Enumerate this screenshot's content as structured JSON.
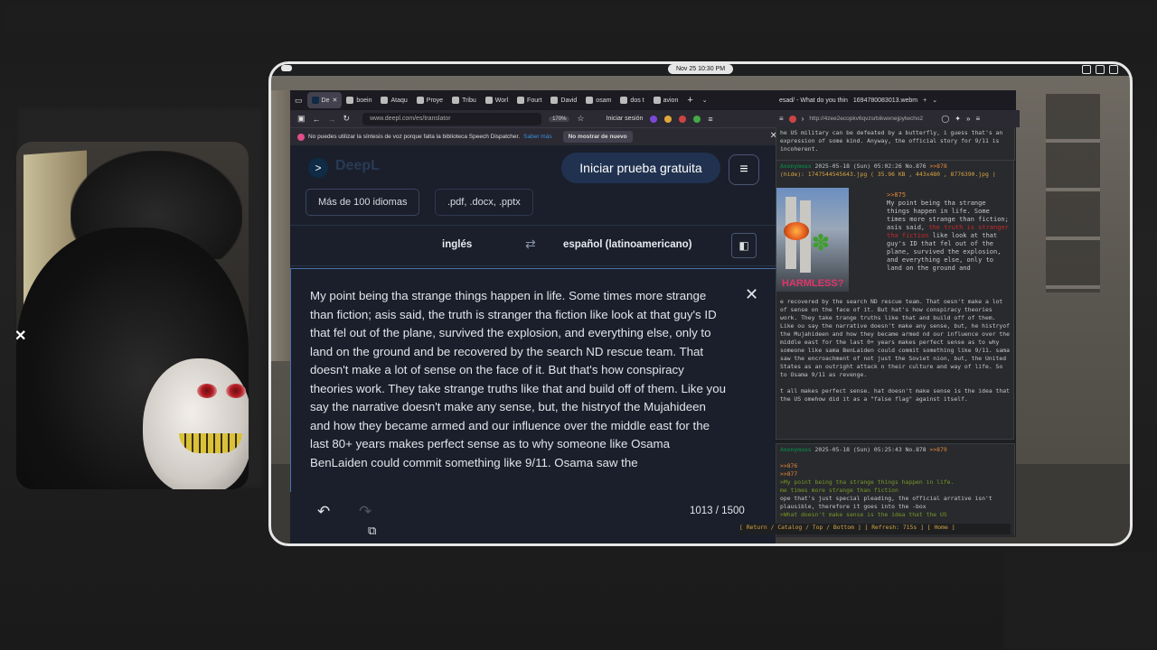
{
  "desktop": {
    "clock": "Nov 25  10:30 PM"
  },
  "left_browser": {
    "tabs": [
      {
        "label": "De",
        "active": true
      },
      {
        "label": "boein"
      },
      {
        "label": "Ataqu"
      },
      {
        "label": "Proye"
      },
      {
        "label": "Tribu"
      },
      {
        "label": "Worl"
      },
      {
        "label": "Fourt"
      },
      {
        "label": "David"
      },
      {
        "label": "osam"
      },
      {
        "label": "dos t"
      },
      {
        "label": "avion"
      }
    ],
    "url": "www.deepl.com/es/translator",
    "zoom": "170%",
    "signin": "Iniciar sesión",
    "notice": {
      "text": "No puedes utilizar la síntesis de voz porque falta la biblioteca Speech Dispatcher.",
      "link": "Saber más",
      "button": "No mostrar de nuevo"
    }
  },
  "deepl": {
    "brand": "DeepL",
    "cta": "Iniciar prueba gratuita",
    "chips": [
      "Más de 100 idiomas",
      ".pdf, .docx, .pptx"
    ],
    "source_lang": "inglés",
    "target_lang": "español (latinoamericano)",
    "text": "My point being tha strange things happen in life. Some times more strange than fiction; asis said, the truth is stranger tha fiction like look at that guy's ID that fel out of the plane, survived the explosion, and everything else, only to land on the ground and be recovered by the search ND rescue team. That doesn't make a lot of sense on the face of it. But that's how conspiracy theories work. They take strange truths like that and build off of them. Like you say the narrative doesn't make any sense, but, the histryof the Mujahideen and how they became armed and our influence over the middle east for the last 80+ years makes perfect sense as to why someone like Osama BenLaiden could commit something like 9/11. Osama saw the",
    "counter": "1013 / 1500"
  },
  "right_browser": {
    "tabs": [
      "esad/ - What do you thin",
      "1694780083013.webm"
    ],
    "url": "http://4zee2ecopkv6qvzsrbikwxnejpylwcho2"
  },
  "board": {
    "post0_tail": "he US military can be defeated by a butterfly, i guess that's an expression of some kind. Anyway, the official story for 9/11 is incoherent.",
    "post1": {
      "name": "Anonymous",
      "date": "2025-05-18 (Sun) 05:02:26 No.876",
      "backref": ">>878",
      "file": "(hide): 1747544545643.jpg ( 35.96 KB , 443x480 , 8776390.jpg )",
      "thumb_caption": "HARMLESS?",
      "quote": ">>875",
      "body_a": "My point being tha strange things happen in life. Some times more strange than fiction; asis said,",
      "body_red": "the truth is stranger tha fiction",
      "body_b": "like look at that guy's ID that fel out of the plane, survived the explosion, and everything else, only to land on the ground and",
      "body_c": "e recovered by the search ND rescue team. That oesn't make a lot of sense on the face of it. But hat's how conspiracy theories work. They take trange truths like that and build off of them. Like ou say the narrative doesn't make any sense, but, he histryof the Mujahideen and how they became armed nd our influence over the middle east for the last 0+ years makes perfect sense as to why someone like sama BenLaiden could commit something like 9/11. sama saw the encroachment of not just the Soviet nion, but, the United States as an outright attack n their culture and way of life. So to Osama 9/11 as revenge.",
      "body_d": "t all makes perfect sense. hat doesn't make sense is the idea that the US omehow did it as a \"false flag\" against itself."
    },
    "post2": {
      "name": "Anonymous",
      "date": "2025-05-18 (Sun) 05:25:43 No.878",
      "backref": ">>879",
      "quotes": [
        ">>876",
        ">>877"
      ],
      "greentext": [
        ">My point being tha strange things happen in life.",
        "me times more strange than fiction"
      ],
      "body": "ope that's just special pleading, the official arrative isn't plausible, therefore it goes into the -box",
      "tail": ">What doesn't make sense is the idea that the US"
    },
    "statusbar": "[ Return / Catalog / Top / Bottom ] [ Refresh: 715s ]      [ Home ]"
  }
}
